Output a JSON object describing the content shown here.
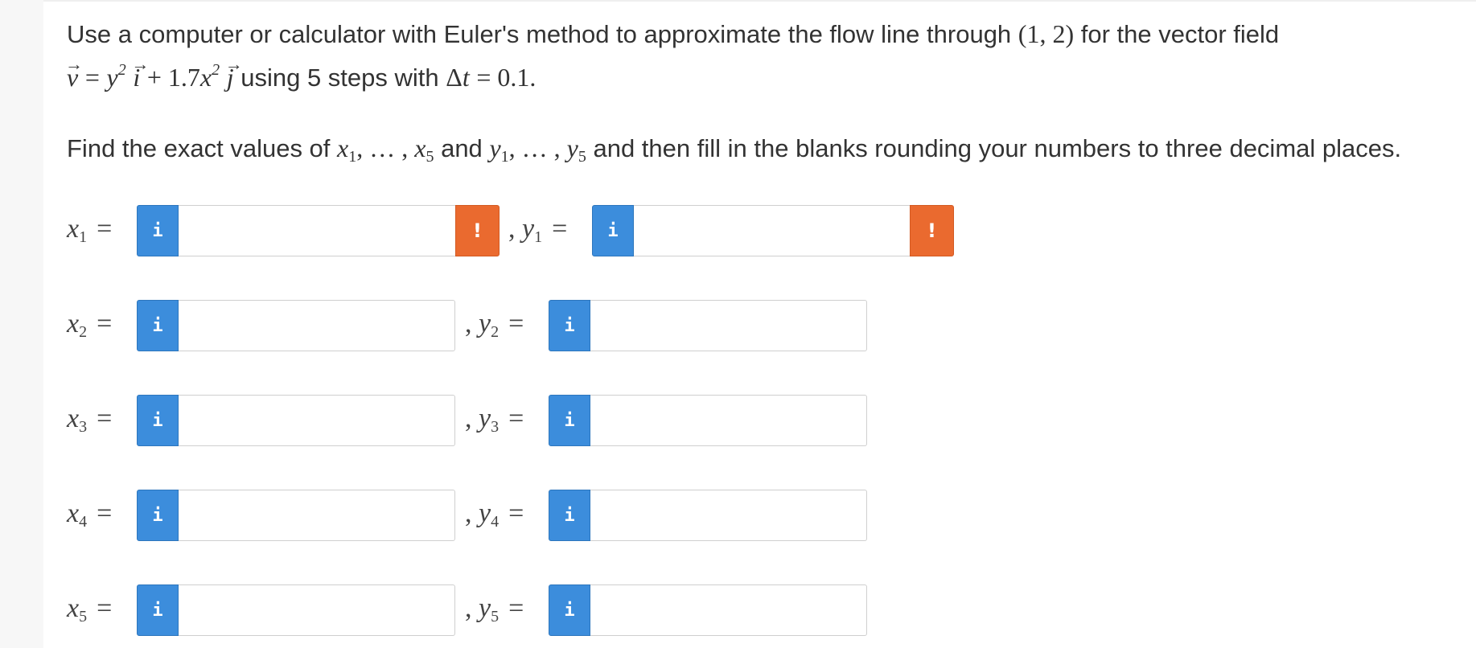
{
  "problem": {
    "intro_text": "Use a computer or calculator with Euler's method to approximate the flow line through",
    "point": "(1, 2)",
    "intro_tail": "for the vector field",
    "vec_v": "v",
    "eq": "=",
    "y_term": "y",
    "exp2": "2",
    "vec_i": "i",
    "plus_coef": "+ 1.7",
    "x_term": "x",
    "vec_j": "j",
    "using_text": "using 5 steps with",
    "dt_text": "Δ",
    "t_var": "t",
    "dt_value": "= 0.1.",
    "instruction_a": "Find the exact values of",
    "seq_x": "x",
    "sub1": "1",
    "ellipsis": ", … ,",
    "sub5": "5",
    "and_text": "and",
    "seq_y": "y",
    "instruction_b": "and then fill in the blanks rounding your numbers to three decimal places."
  },
  "rows": [
    {
      "x_var": "x",
      "x_sub": "1",
      "y_var": "y",
      "y_sub": "1",
      "x_value": "",
      "y_value": "",
      "warning": true
    },
    {
      "x_var": "x",
      "x_sub": "2",
      "y_var": "y",
      "y_sub": "2",
      "x_value": "",
      "y_value": "",
      "warning": false
    },
    {
      "x_var": "x",
      "x_sub": "3",
      "y_var": "y",
      "y_sub": "3",
      "x_value": "",
      "y_value": "",
      "warning": false
    },
    {
      "x_var": "x",
      "x_sub": "4",
      "y_var": "y",
      "y_sub": "4",
      "x_value": "",
      "y_value": "",
      "warning": false
    },
    {
      "x_var": "x",
      "x_sub": "5",
      "y_var": "y",
      "y_sub": "5",
      "x_value": "",
      "y_value": "",
      "warning": false
    }
  ],
  "ui": {
    "eq_sign": "=",
    "comma": ",",
    "info_glyph": "i",
    "warn_glyph": "!",
    "info_icon": "info-icon",
    "warn_icon": "warning-icon",
    "info_color": "#3c8ddc",
    "warn_color": "#ea6a2f"
  }
}
